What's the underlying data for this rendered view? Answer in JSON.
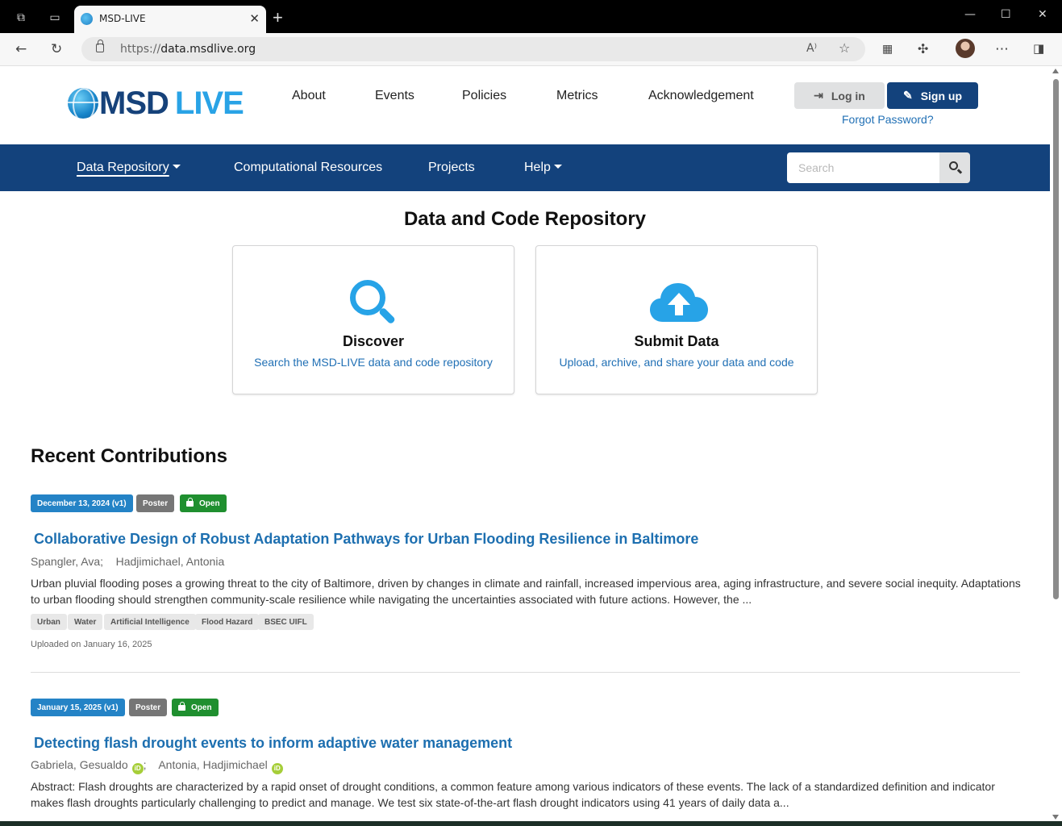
{
  "browser": {
    "tab_title": "MSD-LIVE",
    "url_scheme": "https://",
    "url_host": "data.msdlive.org"
  },
  "header": {
    "logo_msd": "MSD",
    "logo_live": "LIVE",
    "nav": [
      "About",
      "Events",
      "Policies",
      "Metrics",
      "Acknowledgement"
    ],
    "login_label": "Log in",
    "signup_label": "Sign up",
    "forgot_label": "Forgot Password?"
  },
  "bluenav": {
    "items": [
      "Data Repository",
      "Computational Resources",
      "Projects",
      "Help"
    ],
    "search_placeholder": "Search"
  },
  "repo": {
    "title": "Data and Code Repository",
    "cards": [
      {
        "title": "Discover",
        "subtitle": "Search the MSD-LIVE data and code repository",
        "icon": "search-icon"
      },
      {
        "title": "Submit Data",
        "subtitle": "Upload, archive, and share your data and code",
        "icon": "cloud-upload-icon"
      }
    ]
  },
  "recent": {
    "title": "Recent Contributions",
    "records": [
      {
        "date": "December 13, 2024 (v1)",
        "type": "Poster",
        "access": "Open",
        "title": "Collaborative Design of Robust Adaptation Pathways for Urban Flooding Resilience in Baltimore",
        "authors": [
          "Spangler, Ava",
          "Hadjimichael, Antonia"
        ],
        "abstract": "Urban pluvial flooding poses a growing threat to the city of Baltimore, driven by changes in climate and rainfall, increased impervious area, aging infrastructure, and severe social inequity. Adaptations to urban flooding should strengthen community-scale resilience while navigating the uncertainties associated with future actions. However, the ...",
        "keywords": [
          "Urban",
          "Water",
          "Artificial Intelligence",
          "Flood Hazard",
          "BSEC UIFL"
        ],
        "uploaded": "Uploaded on January 16, 2025"
      },
      {
        "date": "January 15, 2025 (v1)",
        "type": "Poster",
        "access": "Open",
        "title": "Detecting flash drought events to inform adaptive water management",
        "authors": [
          "Gabriela, Gesualdo",
          "Antonia, Hadjimichael"
        ],
        "abstract": "Abstract: Flash droughts are characterized by a rapid onset of drought conditions, a common feature among various indicators of these events. The lack of a standardized definition and indicator makes flash droughts particularly challenging to predict and manage. We test six state-of-the-art flash drought indicators using 41 years of daily data a..."
      }
    ]
  },
  "colors": {
    "brand_dark": "#13427c",
    "brand_light": "#27a3e7",
    "link": "#1d6fb0",
    "open_green": "#1f8f2f"
  }
}
